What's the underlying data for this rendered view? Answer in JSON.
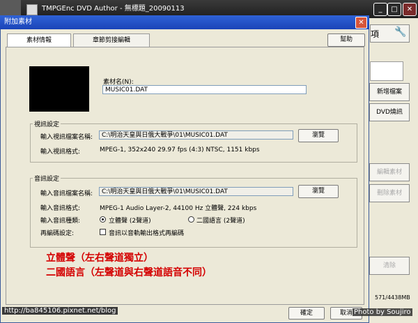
{
  "main_window": {
    "title": "TMPGEnc DVD Author - 無標題_20090113",
    "min_label": "_",
    "max_label": "□",
    "close_label": "✕",
    "right_buttons": [
      "新增檔案",
      "DVD燒訊",
      "編輯素材",
      "刪除素材",
      "清除"
    ],
    "fragment_label": "項",
    "status_text": "571/4438MB"
  },
  "dialog": {
    "title": "附加素材",
    "close_label": "✕",
    "tabs": [
      "素材情報",
      "章節剪接編輯"
    ],
    "help_label": "幫助",
    "name_label": "素材名(N):",
    "name_value": "MUSIC01.DAT",
    "video_group": {
      "legend": "視訊設定",
      "file_label": "輸入視訊檔案名稱:",
      "file_value": "C:\\明治天皇與日俄大戰爭\\01\\MUSIC01.DAT",
      "browse_label": "瀏覽",
      "format_label": "輸入視訊格式:",
      "format_value": "MPEG-1, 352x240 29.97 fps (4:3) NTSC, 1151 kbps"
    },
    "audio_group": {
      "legend": "音訊設定",
      "file_label": "輸入音訊檔案名稱:",
      "file_value": "C:\\明治天皇與日俄大戰爭\\01\\MUSIC01.DAT",
      "browse_label": "瀏覽",
      "format_label": "輸入音訊格式:",
      "format_value": "MPEG-1 Audio Layer-2, 44100 Hz 立體聲, 224 kbps",
      "type_label": "輸入音訊種類:",
      "radio_stereo": "立體聲 (2聲道)",
      "radio_bilingual": "二國語言 (2聲道)",
      "reencode_label": "再編碼設定:",
      "reencode_check": "音訊以音軌輸出格式再編碼"
    },
    "ok_label": "確定",
    "cancel_label": "取消"
  },
  "annotations": {
    "line1": "立體聲（左右聲道獨立）",
    "line2": "二國語言（左聲道與右聲道語音不同）"
  },
  "watermark": {
    "url": "http://ba845106.pixnet.net/blog",
    "credit": "Photo by Soujiro"
  }
}
